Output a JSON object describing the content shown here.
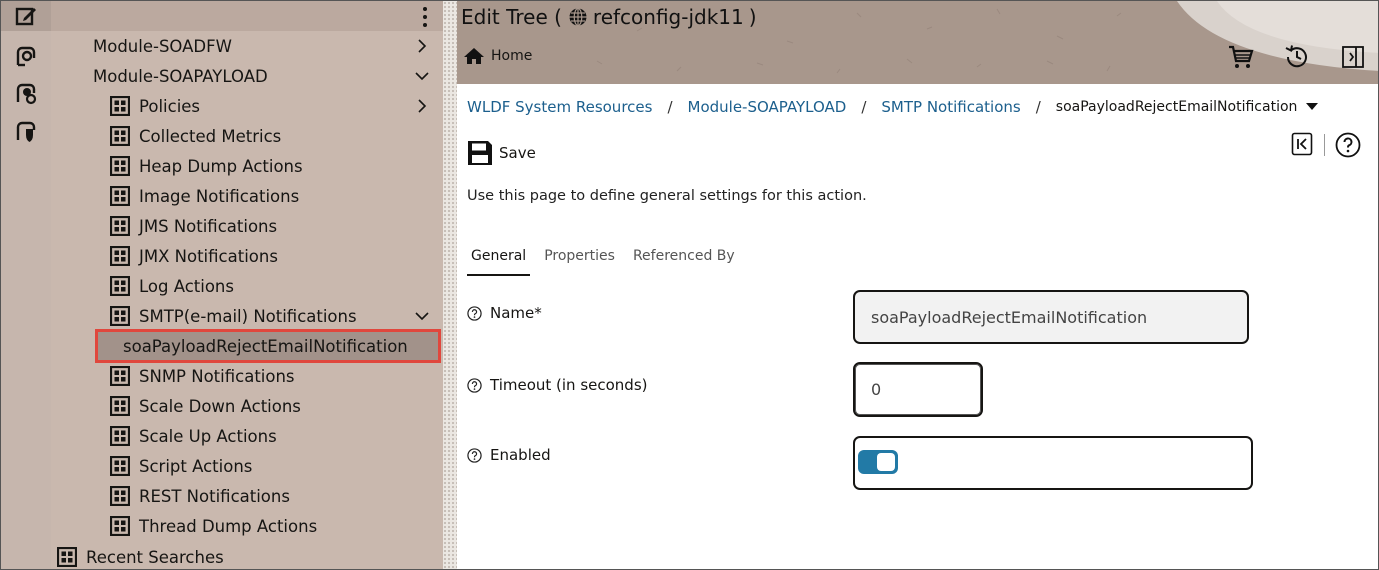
{
  "header": {
    "title_prefix": "Edit Tree (",
    "title_config": "refconfig-jdk11",
    "title_suffix": ")",
    "home_label": "Home"
  },
  "tree": {
    "items": [
      {
        "label": "Module-SOADFW",
        "chevron": "right"
      },
      {
        "label": "Module-SOAPAYLOAD",
        "chevron": "down"
      },
      {
        "label": "Policies",
        "chevron": "right"
      },
      {
        "label": "Collected Metrics"
      },
      {
        "label": "Heap Dump Actions"
      },
      {
        "label": "Image Notifications"
      },
      {
        "label": "JMS Notifications"
      },
      {
        "label": "JMX Notifications"
      },
      {
        "label": "Log Actions"
      },
      {
        "label": "SMTP(e-mail) Notifications",
        "chevron": "down"
      },
      {
        "label": "soaPayloadRejectEmailNotification",
        "selected": true
      },
      {
        "label": "SNMP Notifications"
      },
      {
        "label": "Scale Down Actions"
      },
      {
        "label": "Scale Up Actions"
      },
      {
        "label": "Script Actions"
      },
      {
        "label": "REST Notifications"
      },
      {
        "label": "Thread Dump Actions"
      },
      {
        "label": "Recent Searches"
      }
    ]
  },
  "breadcrumb": {
    "items": [
      "WLDF System Resources",
      "Module-SOAPAYLOAD",
      "SMTP Notifications"
    ],
    "separator": "/",
    "current": "soaPayloadRejectEmailNotification"
  },
  "toolbar": {
    "save_label": "Save"
  },
  "intro_text": "Use this page to define general settings for this action.",
  "tabs": [
    "General",
    "Properties",
    "Referenced By"
  ],
  "active_tab": "General",
  "form": {
    "name_label": "Name*",
    "name_value": "soaPayloadRejectEmailNotification",
    "timeout_label": "Timeout (in seconds)",
    "timeout_value": "0",
    "enabled_label": "Enabled",
    "enabled_value": true
  },
  "colors": {
    "link": "#1c5f8d",
    "toggle_on": "#227aa6",
    "selection_border": "#e0473d",
    "tree_bg": "#c9b8ae"
  }
}
